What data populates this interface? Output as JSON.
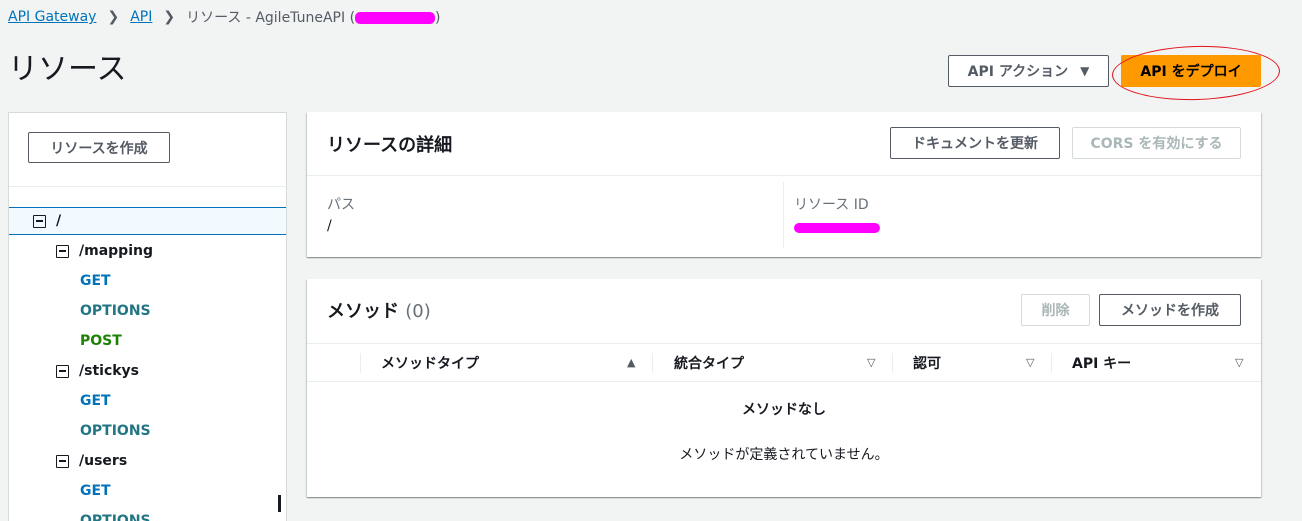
{
  "breadcrumb": {
    "item1": "API Gateway",
    "item2": "API",
    "current_prefix": "リソース - AgileTuneAPI (",
    "current_suffix": ")"
  },
  "page": {
    "title": "リソース"
  },
  "header_actions": {
    "api_actions": "API アクション",
    "deploy": "API をデプロイ"
  },
  "sidebar": {
    "create_resource": "リソースを作成",
    "tree": {
      "root": "/",
      "resources": [
        {
          "path": "/mapping",
          "methods": [
            "GET",
            "OPTIONS",
            "POST"
          ]
        },
        {
          "path": "/stickys",
          "methods": [
            "GET",
            "OPTIONS"
          ]
        },
        {
          "path": "/users",
          "methods": [
            "GET",
            "OPTIONS"
          ]
        }
      ]
    }
  },
  "details": {
    "title": "リソースの詳細",
    "update_docs": "ドキュメントを更新",
    "enable_cors": "CORS を有効にする",
    "path_label": "パス",
    "path_value": "/",
    "resource_id_label": "リソース ID"
  },
  "methods": {
    "title": "メソッド",
    "count": "(0)",
    "delete": "削除",
    "create": "メソッドを作成",
    "columns": [
      "メソッドタイプ",
      "統合タイプ",
      "認可",
      "API キー"
    ],
    "empty_title": "メソッドなし",
    "empty_sub": "メソッドが定義されていません。"
  },
  "colors": {
    "link": "#0073bb",
    "deploy_button": "#ff9900",
    "redaction": "#ff00ff",
    "annotation": "#e0101a"
  }
}
